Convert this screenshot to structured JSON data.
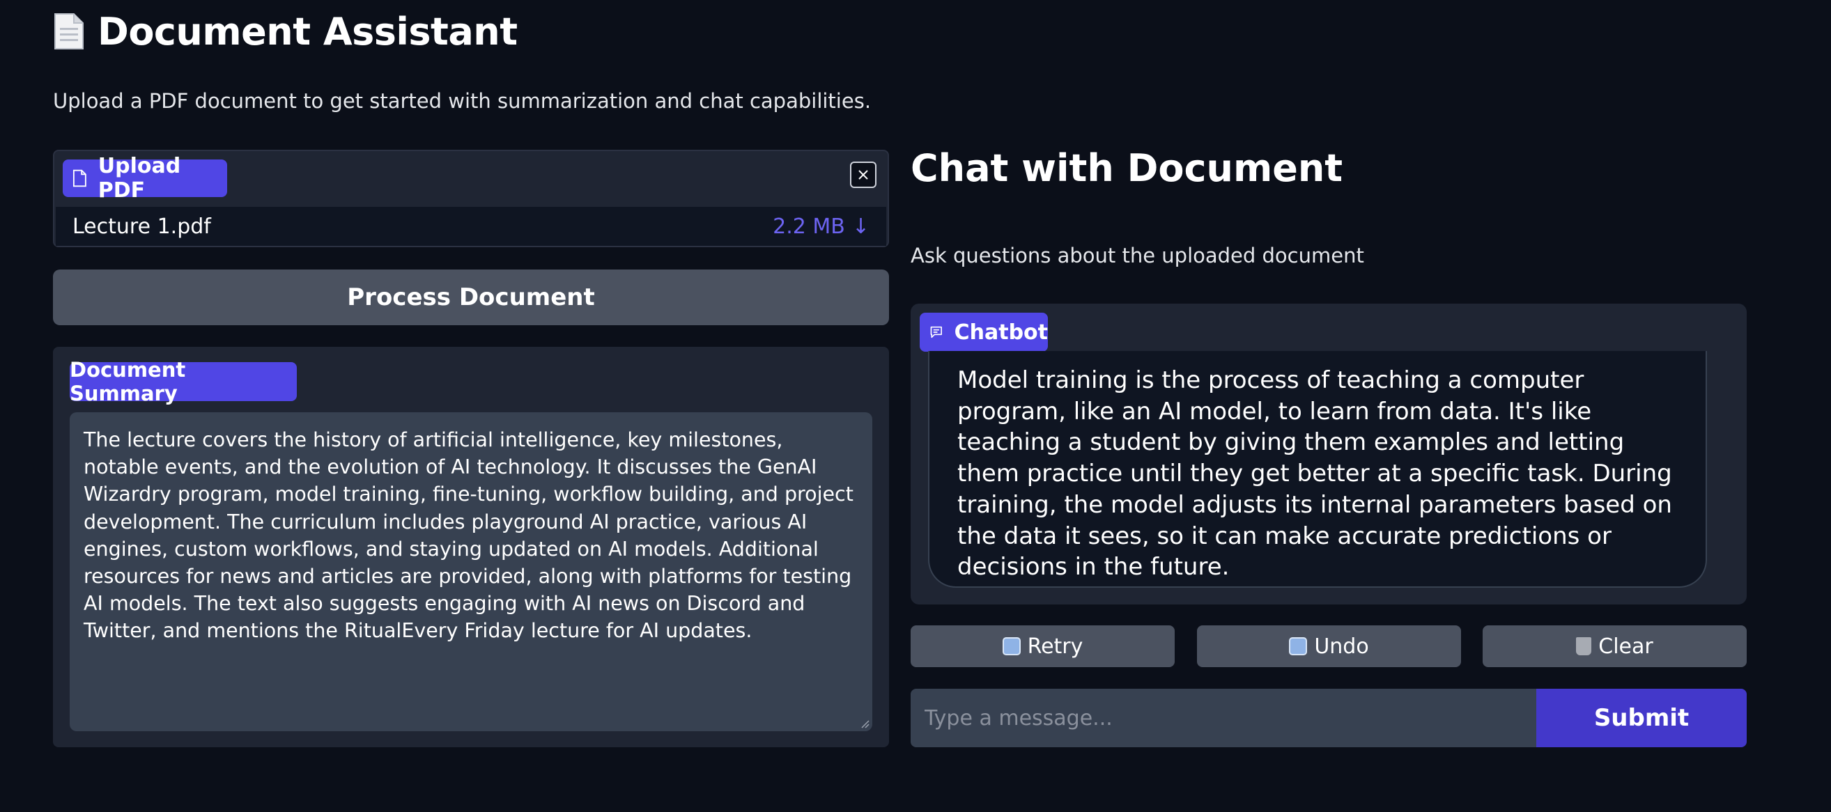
{
  "header": {
    "title": "Document Assistant",
    "icon": "page-facing-up-icon",
    "subtitle": "Upload a PDF document to get started with summarization and chat capabilities."
  },
  "upload": {
    "label": "Upload PDF",
    "file_name": "Lecture 1.pdf",
    "file_size": "2.2 MB",
    "download_icon": "↓"
  },
  "process_button": "Process Document",
  "summary": {
    "label": "Document Summary",
    "text": "The lecture covers the history of artificial intelligence, key milestones, notable events, and the evolution of AI technology. It discusses the GenAI Wizardry program, model training, fine-tuning, workflow building, and project development. The curriculum includes playground AI practice, various AI engines, custom workflows, and staying updated on AI models. Additional resources for news and articles are provided, along with platforms for testing AI models. The text also suggests engaging with AI news on Discord and Twitter, and mentions the RitualEvery Friday lecture for AI updates."
  },
  "chat": {
    "title": "Chat with Document",
    "description": "Ask questions about the uploaded document",
    "chatbot_label": "Chatbot",
    "messages": [
      "Model training is the process of teaching a computer program, like an AI model, to learn from data. It's like teaching a student by giving them examples and letting them practice until they get better at a specific task. During training, the model adjusts its internal parameters based on the data it sees, so it can make accurate predictions or decisions in the future."
    ],
    "retry_label": "Retry",
    "undo_label": "Undo",
    "clear_label": "Clear",
    "input_placeholder": "Type a message...",
    "submit_label": "Submit"
  },
  "colors": {
    "background": "#0b0f19",
    "panel": "#1f2533",
    "accent": "#5046e5",
    "button": "#4b5260",
    "submit": "#4338ca"
  }
}
